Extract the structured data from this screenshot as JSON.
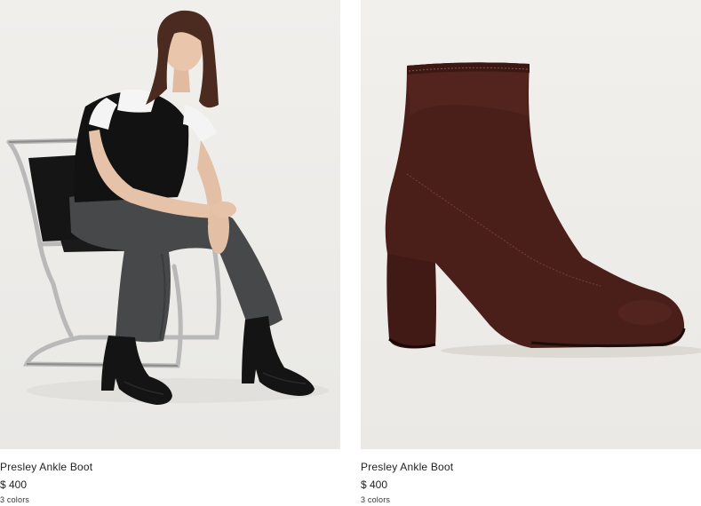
{
  "products": [
    {
      "name": "Presley Ankle Boot",
      "price": "$ 400",
      "colors": "3 colors",
      "image_alt": "model-seated-wearing-black-boots"
    },
    {
      "name": "Presley Ankle Boot",
      "price": "$ 400",
      "colors": "3 colors",
      "image_alt": "brown-suede-ankle-boot"
    }
  ],
  "palette": {
    "boot_suede": "#4a1e18",
    "boot_black": "#141414",
    "background": "#efedea"
  }
}
